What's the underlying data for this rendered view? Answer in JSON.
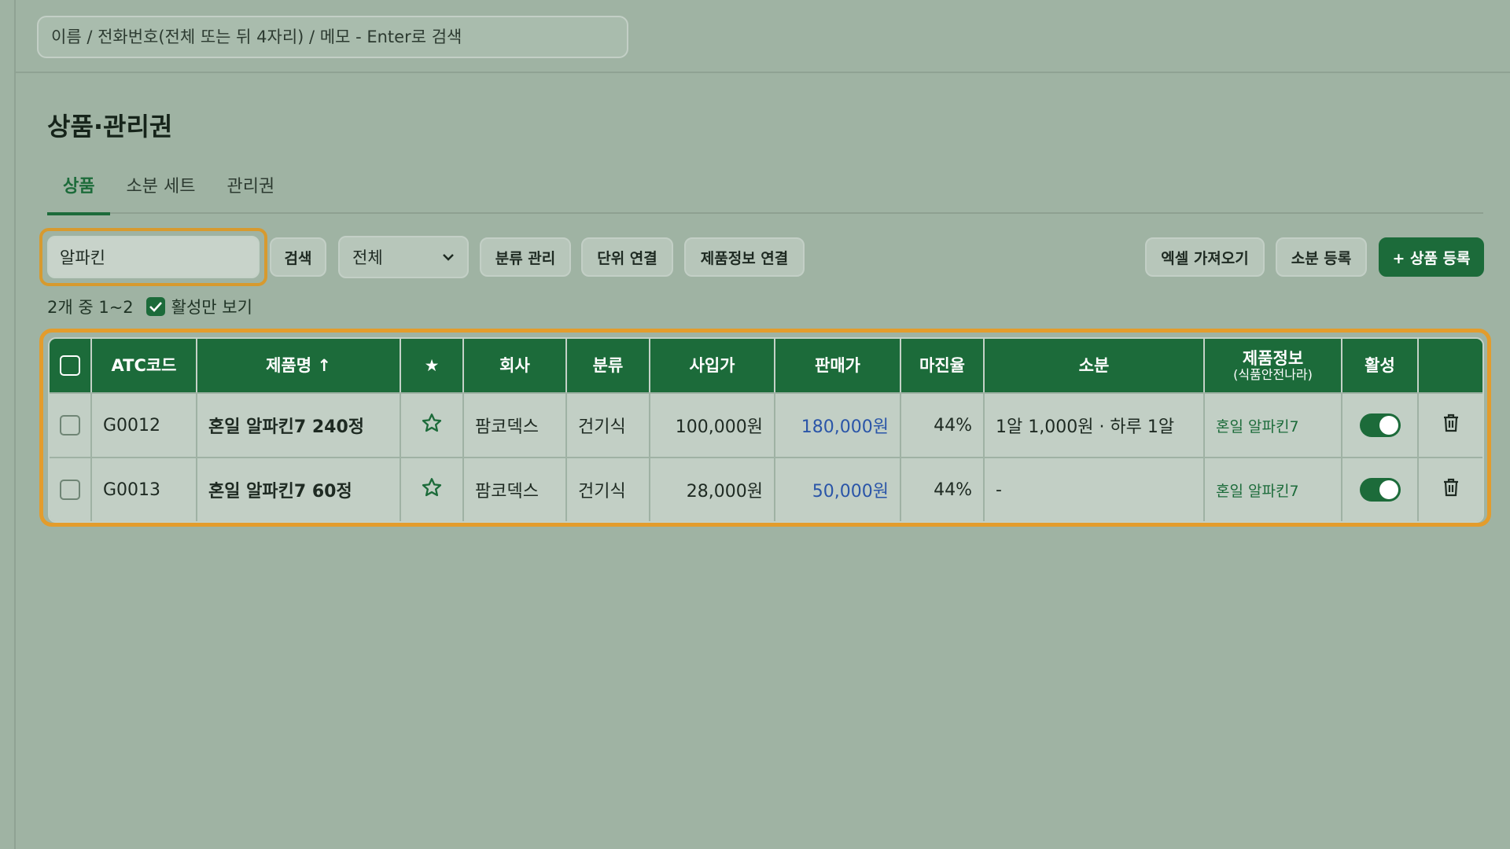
{
  "topbar": {
    "search_placeholder": "이름 / 전화번호(전체 또는 뒤 4자리) / 메모 - Enter로 검색"
  },
  "page": {
    "title": "상품·관리권"
  },
  "tabs": [
    {
      "label": "상품",
      "active": true
    },
    {
      "label": "소분 세트",
      "active": false
    },
    {
      "label": "관리권",
      "active": false
    }
  ],
  "toolbar": {
    "search_value": "알파킨",
    "search_button": "검색",
    "category_select": "전체",
    "category_manage": "분류 관리",
    "unit_link": "단위 연결",
    "product_info_link": "제품정보 연결",
    "excel_import": "엑셀 가져오기",
    "portion_register": "소분 등록",
    "product_register": "+ 상품 등록"
  },
  "list_info": {
    "count_text": "2개 중 1~2",
    "active_only_label": "활성만 보기",
    "active_only_checked": true
  },
  "table": {
    "headers": {
      "atc": "ATC코드",
      "name": "제품명 ↑",
      "star": "★",
      "company": "회사",
      "category": "분류",
      "cost": "사입가",
      "price": "판매가",
      "margin": "마진율",
      "portion": "소분",
      "info_main": "제품정보",
      "info_sub": "(식품안전나라)",
      "active": "활성"
    },
    "rows": [
      {
        "atc": "G0012",
        "name": "혼일 알파킨7 240정",
        "company": "팜코덱스",
        "category": "건기식",
        "cost": "100,000원",
        "price": "180,000원",
        "margin": "44%",
        "portion": "1알 1,000원 · 하루 1알",
        "info": "혼일 알파킨7",
        "active": true
      },
      {
        "atc": "G0013",
        "name": "혼일 알파킨7 60정",
        "company": "팜코덱스",
        "category": "건기식",
        "cost": "28,000원",
        "price": "50,000원",
        "margin": "44%",
        "portion": "-",
        "info": "혼일 알파킨7",
        "active": true
      }
    ]
  },
  "colors": {
    "accent": "#1c6b3a",
    "highlight": "#e39c2c",
    "price_link": "#2a55a8",
    "background": "#9fb3a3"
  }
}
